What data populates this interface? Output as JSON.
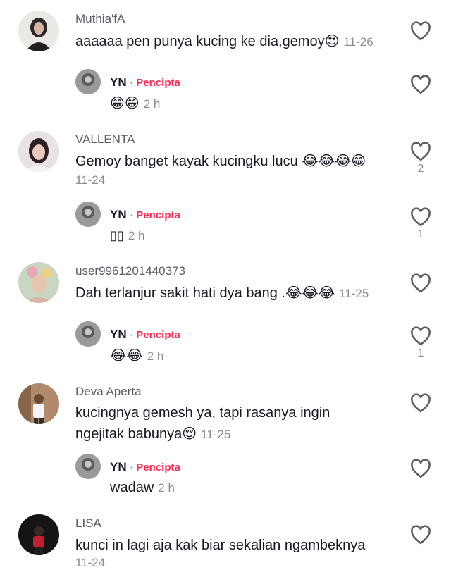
{
  "comments": [
    {
      "user": "Muthia'fA",
      "text": "aaaaaa pen punya kucing ke dia,gemoy",
      "emoji": "😍",
      "time": "11-26",
      "likes": "",
      "reply": {
        "user": "YN",
        "sep": "·",
        "badge": "Pencipta",
        "text": "",
        "emoji": "😁😁",
        "time": "2 h",
        "likes": ""
      }
    },
    {
      "user": "VALLENTA",
      "text": "Gemoy banget kayak kucingku lucu",
      "emoji": "😂😂😂😁",
      "time": "11-24",
      "likes": "2",
      "reply": {
        "user": "YN",
        "sep": "·",
        "badge": "Pencipta",
        "text": "",
        "emoji": "▯▯",
        "time": "2 h",
        "likes": "1"
      }
    },
    {
      "user": "user9961201440373",
      "text": "Dah terlanjur sakit hati dya bang .",
      "emoji": "😂😂😂",
      "time": "11-25",
      "likes": "",
      "reply": {
        "user": "YN",
        "sep": "·",
        "badge": "Pencipta",
        "text": "",
        "emoji": "😂😂",
        "time": "2 h",
        "likes": "1"
      }
    },
    {
      "user": "Deva Aperta",
      "text_line1": "kucingnya gemesh ya, tapi rasanya ingin",
      "text_line2": "ngejitak babunya",
      "emoji": "😌",
      "time": "11-25",
      "likes": "",
      "reply": {
        "user": "YN",
        "sep": "·",
        "badge": "Pencipta",
        "text": "wadaw",
        "emoji": "",
        "time": "2 h",
        "likes": ""
      }
    },
    {
      "user": "LISA",
      "text": "kunci in lagi aja kak biar sekalian ngambeknya",
      "time": "11-24",
      "likes": ""
    }
  ],
  "icons": {
    "like": "heart-outline-icon"
  }
}
